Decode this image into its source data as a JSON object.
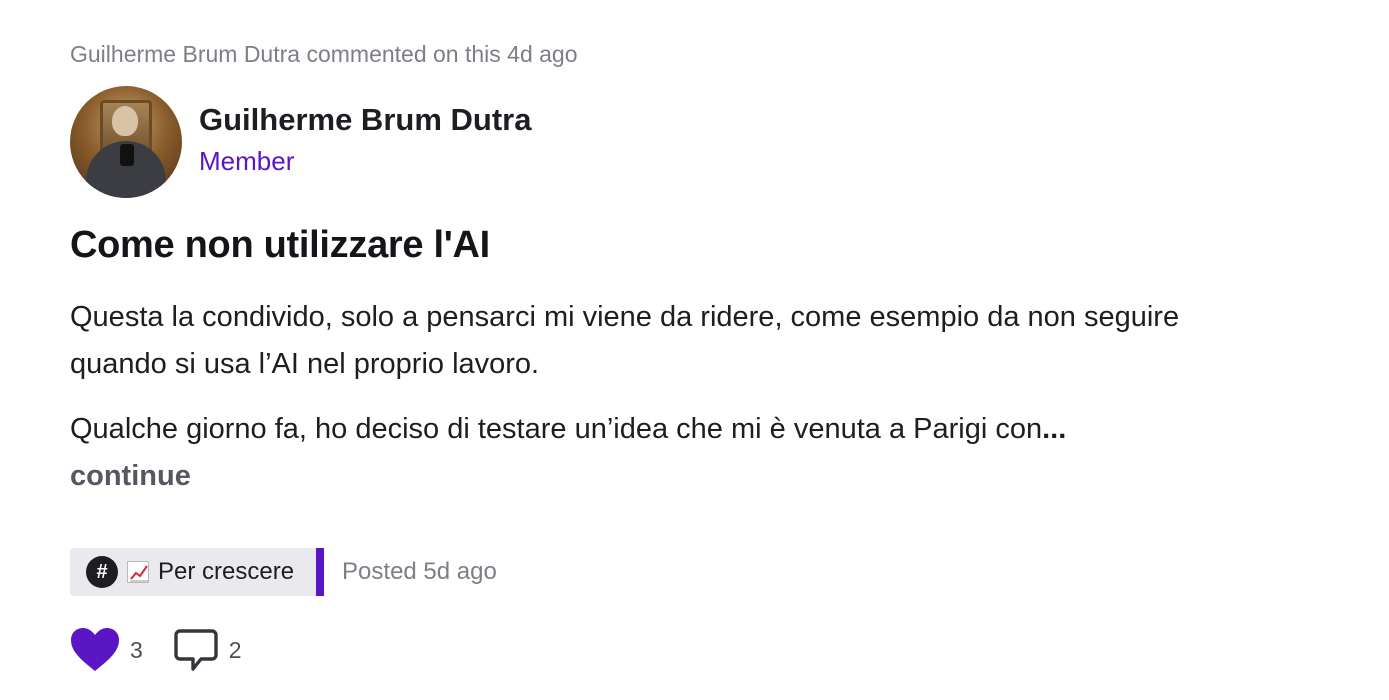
{
  "activity": "Guilherme Brum Dutra commented on this 4d ago",
  "author": {
    "name": "Guilherme Brum Dutra",
    "role": "Member"
  },
  "post": {
    "title": "Come non utilizzare l'AI",
    "paragraph1": "Questa la condivido, solo a pensarci mi viene da ridere, come esempio da non seguire quando si usa l’AI nel proprio lavoro.",
    "paragraph2": "Qualche giorno fa, ho deciso di testare un’idea che mi è venuta a Parigi con",
    "ellipsis": "...",
    "continue_label": "continue"
  },
  "footer": {
    "tag_hash": "#",
    "tag_icon": "chart-increasing-emoji",
    "tag_label": "Per crescere",
    "posted": "Posted 5d ago"
  },
  "actions": {
    "likes": "3",
    "comments": "2"
  },
  "colors": {
    "accent": "#5a16c4",
    "muted": "#7c7f86",
    "tag_bg": "#e9e9ee"
  }
}
